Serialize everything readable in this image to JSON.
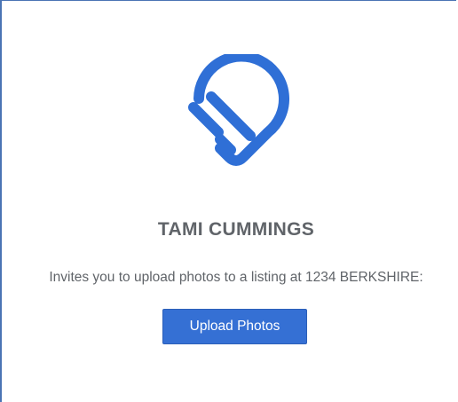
{
  "header": {
    "logo_icon": "pin-stripes-logo-icon",
    "brand_color": "#2f6fd6"
  },
  "invite": {
    "sender_name": "TAMI CUMMINGS",
    "message": "Invites you to upload photos to a listing at 1234 BERKSHIRE:"
  },
  "actions": {
    "upload_label": "Upload Photos",
    "button_color": "#3570d4"
  }
}
